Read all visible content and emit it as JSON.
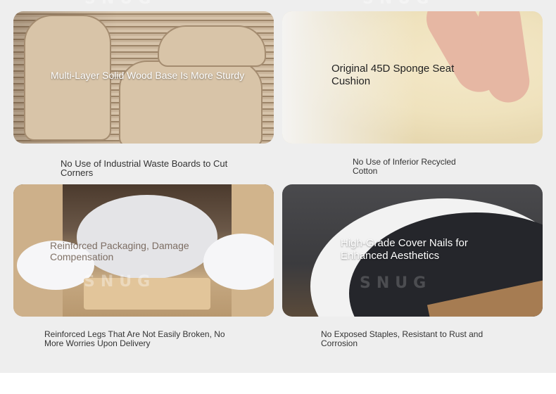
{
  "watermark": "SNUG",
  "cards": [
    {
      "label": "Multi-Layer Solid Wood Base Is More Sturdy",
      "caption": "No Use of Industrial Waste Boards to Cut Corners"
    },
    {
      "label": "Original 45D Sponge Seat Cushion",
      "caption": "No Use of Inferior Recycled Cotton"
    },
    {
      "label": "Reinforced Packaging, Damage Compensation",
      "caption": "Reinforced Legs That Are Not Easily Broken, No More Worries Upon Delivery"
    },
    {
      "label": "High-Grade Cover Nails for Enhanced Aesthetics",
      "caption": "No Exposed Staples, Resistant to Rust and Corrosion"
    }
  ]
}
